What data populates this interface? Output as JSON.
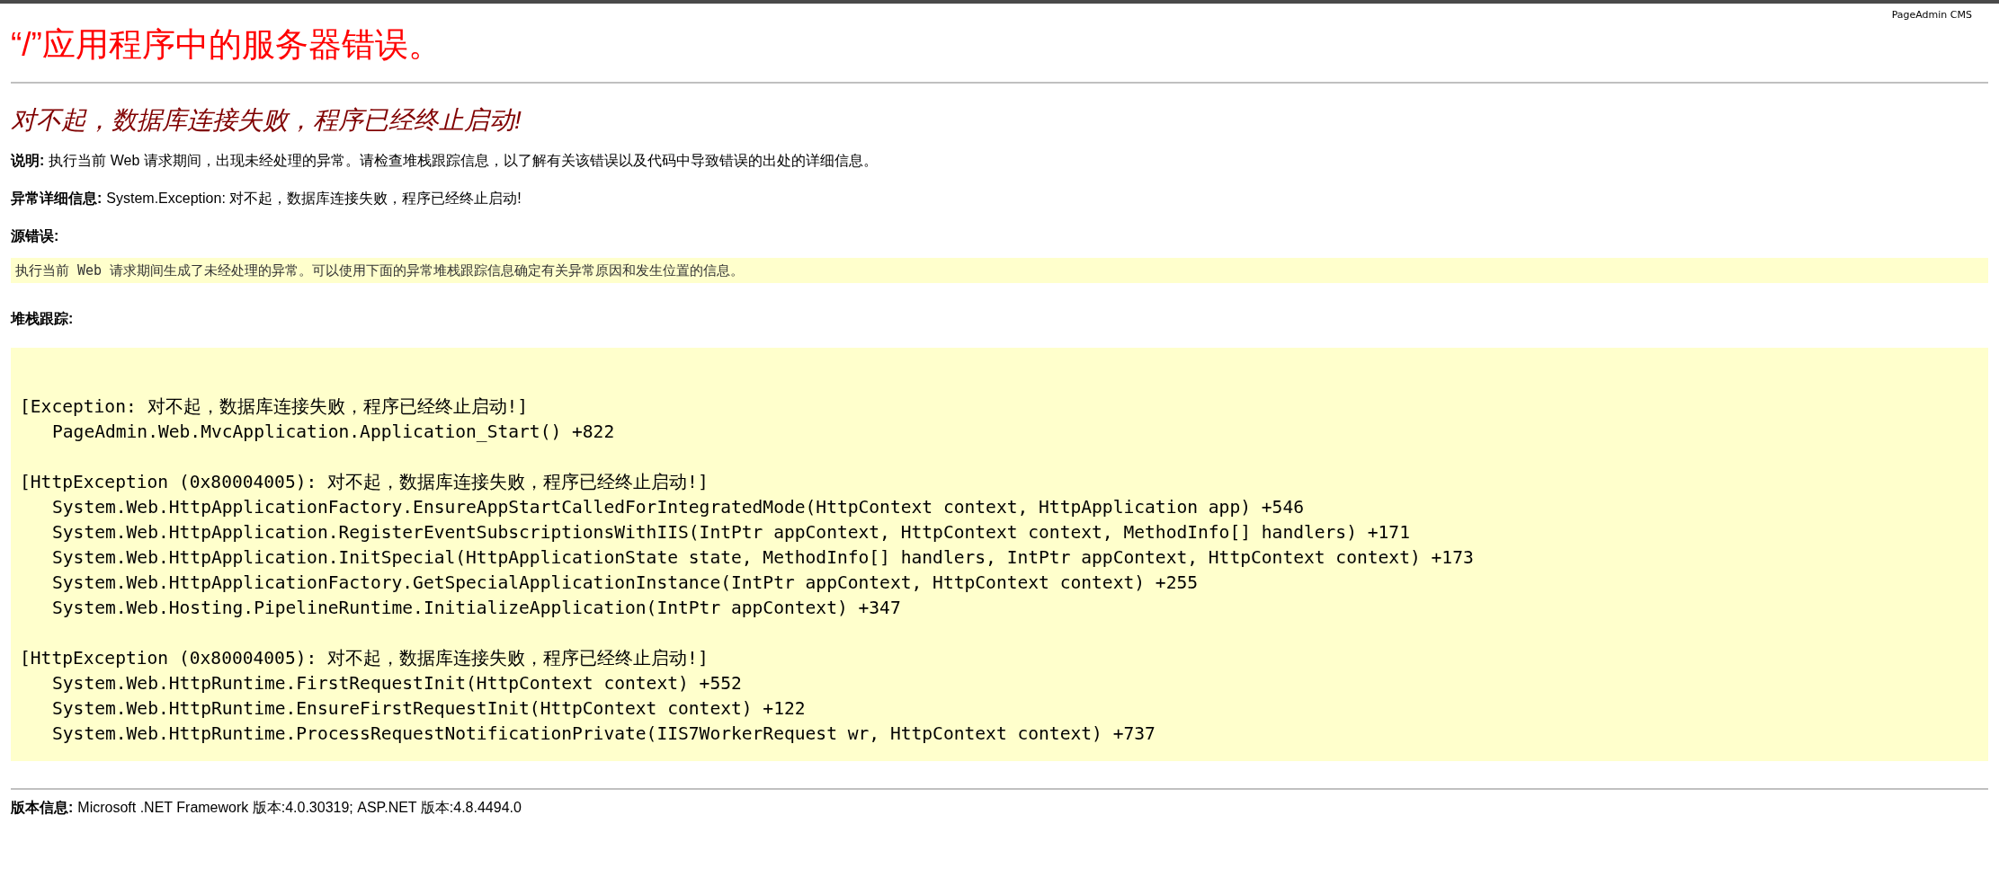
{
  "brand": "PageAdmin CMS",
  "title": "“/”应用程序中的服务器错误。",
  "subtitle": "对不起，数据库连接失败，程序已经终止启动!",
  "description": {
    "label": "说明:",
    "text": "执行当前 Web 请求期间，出现未经处理的异常。请检查堆栈跟踪信息，以了解有关该错误以及代码中导致错误的出处的详细信息。"
  },
  "exception_details": {
    "label": "异常详细信息:",
    "text": "System.Exception: 对不起，数据库连接失败，程序已经终止启动!"
  },
  "source_error": {
    "label": "源错误:",
    "text": "执行当前 Web 请求期间生成了未经处理的异常。可以使用下面的异常堆栈跟踪信息确定有关异常原因和发生位置的信息。"
  },
  "stack_trace": {
    "label": "堆栈跟踪:",
    "groups": [
      {
        "header": "[Exception: 对不起，数据库连接失败，程序已经终止启动!]",
        "frames": [
          "PageAdmin.Web.MvcApplication.Application_Start() +822"
        ]
      },
      {
        "header": "[HttpException (0x80004005): 对不起，数据库连接失败，程序已经终止启动!]",
        "frames": [
          "System.Web.HttpApplicationFactory.EnsureAppStartCalledForIntegratedMode(HttpContext context, HttpApplication app) +546",
          "System.Web.HttpApplication.RegisterEventSubscriptionsWithIIS(IntPtr appContext, HttpContext context, MethodInfo[] handlers) +171",
          "System.Web.HttpApplication.InitSpecial(HttpApplicationState state, MethodInfo[] handlers, IntPtr appContext, HttpContext context) +173",
          "System.Web.HttpApplicationFactory.GetSpecialApplicationInstance(IntPtr appContext, HttpContext context) +255",
          "System.Web.Hosting.PipelineRuntime.InitializeApplication(IntPtr appContext) +347"
        ]
      },
      {
        "header": "[HttpException (0x80004005): 对不起，数据库连接失败，程序已经终止启动!]",
        "frames": [
          "System.Web.HttpRuntime.FirstRequestInit(HttpContext context) +552",
          "System.Web.HttpRuntime.EnsureFirstRequestInit(HttpContext context) +122",
          "System.Web.HttpRuntime.ProcessRequestNotificationPrivate(IIS7WorkerRequest wr, HttpContext context) +737"
        ]
      }
    ]
  },
  "version": {
    "label": "版本信息:",
    "text": "Microsoft .NET Framework 版本:4.0.30319; ASP.NET 版本:4.8.4494.0"
  }
}
